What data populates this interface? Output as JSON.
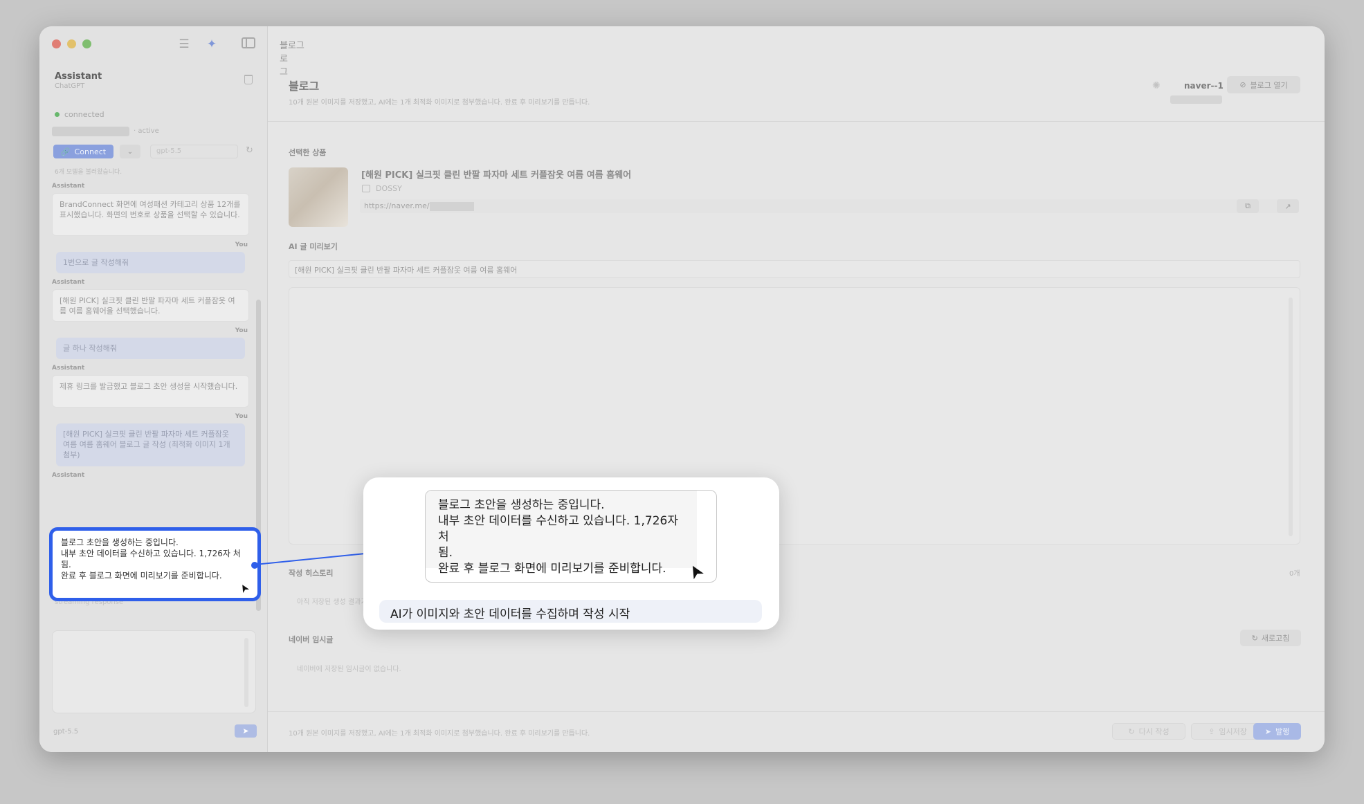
{
  "window": {
    "title": "블로그"
  },
  "sidebar": {
    "assistant_title": "Assistant",
    "assistant_sub": "ChatGPT",
    "status": "connected",
    "account_active": "· active",
    "connect_label": "Connect",
    "model": "gpt-5.5",
    "models_loaded": "6개 모델을 불러왔습니다.",
    "messages": [
      {
        "role": "Assistant",
        "text": "BrandConnect 화면에 여성패션 카테고리 상품 12개를 표시했습니다. 화면의 번호로 상품을 선택할 수 있습니다."
      },
      {
        "role": "You",
        "text": "1번으로 글 작성해줘"
      },
      {
        "role": "Assistant",
        "text": "[해원 PICK] 실크핏 클린 반팔 파자마 세트 커플잠옷 여름 여름 홈웨어을 선택했습니다."
      },
      {
        "role": "You",
        "text": "글 하나 작성해줘"
      },
      {
        "role": "Assistant",
        "text": "제휴 링크를 발급했고 블로그 초안 생성을 시작했습니다."
      },
      {
        "role": "You",
        "text": "[해원 PICK] 실크핏 클린 반팔 파자마 세트 커플잠옷 여름 여름 홈웨어 블로그 글 작성 (최적화 이미지 1개 첨부)"
      },
      {
        "role": "Assistant",
        "text": ""
      }
    ],
    "streaming": "streaming response",
    "footer_model": "gpt-5.5",
    "streaming_message": {
      "line1": "블로그 초안을 생성하는 중입니다.",
      "line2": "내부 초안 데이터를 수신하고 있습니다. 1,726자 처",
      "line3": "됨.",
      "line4": "완료 후 블로그 화면에 미리보기를 준비합니다."
    }
  },
  "main": {
    "page_title": "블로그",
    "description": "10개 원본 이미지를 저장했고, AI에는 1개 최적화 이미지로 첨부했습니다. 완료 후 미리보기를 만듭니다.",
    "account": "naver--1",
    "open_blog": "블로그 열기",
    "selected_product_label": "선택한 상품",
    "product_title": "[해원 PICK] 실크핏 클린 반팔 파자마 세트 커플잠옷 여름 여름 홈웨어",
    "brand": "DOSSY",
    "url": "https://naver.me/",
    "ai_preview_label": "AI 글 미리보기",
    "preview_title": "[해원 PICK] 실크핏 클린 반팔 파자마 세트 커플잠옷 여름 여름 홈웨어",
    "history_label": "작성 히스토리",
    "history_count": "0개",
    "history_empty": "아직 저장된 생성 결과가 없습니다.",
    "naver_drafts_label": "네이버 임시글",
    "refresh": "새로고침",
    "drafts_empty": "네이버에 저장된 임시글이 없습니다.",
    "footer_note": "10개 원본 이미지를 저장했고, AI에는 1개 최적화 이미지로 첨부했습니다. 완료 후 미리보기를 만듭니다.",
    "rewrite": "다시 작성",
    "save_draft": "임시저장",
    "publish": "발행"
  },
  "callout": {
    "caption": "AI가 이미지와 초안 데이터를 수집하며 작성 시작"
  }
}
